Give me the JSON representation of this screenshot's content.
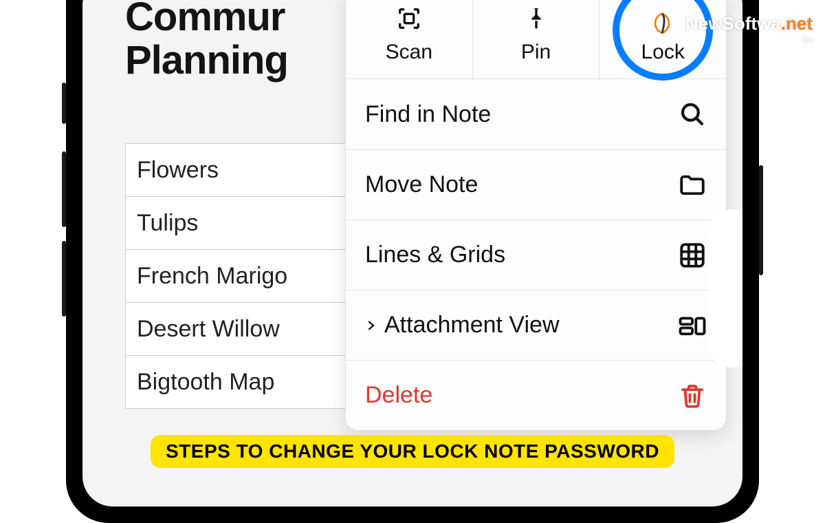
{
  "note": {
    "title_line1": "Commur",
    "title_line2": "Planning",
    "table_rows": [
      "Flowers",
      "Tulips",
      "French Marigo",
      "Desert Willow",
      "Bigtooth Map"
    ]
  },
  "top_actions": {
    "scan": "Scan",
    "pin": "Pin",
    "lock": "Lock"
  },
  "menu": {
    "find": "Find in Note",
    "move": "Move Note",
    "lines": "Lines & Grids",
    "attach": "Attachment View",
    "delete": "Delete"
  },
  "caption": "STEPS TO CHANGE YOUR LOCK NOTE PASSWORD",
  "watermark": {
    "brand": "NewSoftwa",
    "suffix": ".net",
    "sub": "Se"
  },
  "colors": {
    "highlight": "#0a7dff",
    "caption_bg": "#ffe400",
    "danger": "#e2372e",
    "brand_orange": "#f58220"
  }
}
